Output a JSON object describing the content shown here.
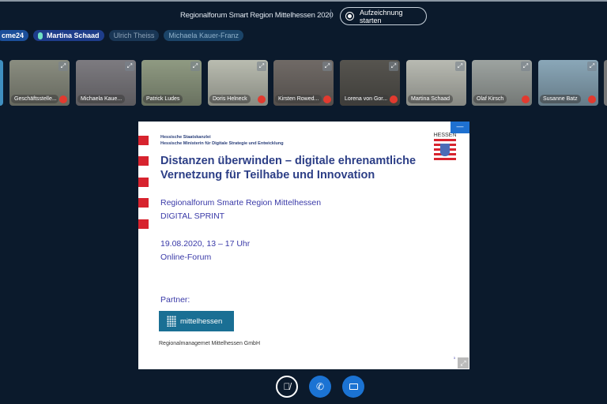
{
  "header": {
    "title": "Regionalforum Smart Region Mittelhessen 2020",
    "record_label": "Aufzeichnung starten"
  },
  "speakers": [
    {
      "name": "cme24",
      "style": "a"
    },
    {
      "name": "Martina Schaad",
      "style": "b"
    },
    {
      "name": "Ulrich Theiss",
      "style": "c"
    },
    {
      "name": "Michaela Kauer-Franz",
      "style": "d"
    }
  ],
  "tiles": [
    {
      "name": "Geschäftsstelle...",
      "muted": true,
      "color": "#8a8d80"
    },
    {
      "name": "Michaela Kaue...",
      "muted": false,
      "color": "#7d7b80"
    },
    {
      "name": "Patrick Ludes",
      "muted": false,
      "color": "#8f9a82"
    },
    {
      "name": "Doris Helneck",
      "muted": true,
      "color": "#b9bcb0"
    },
    {
      "name": "Kirsten Rowed...",
      "muted": true,
      "color": "#706a66"
    },
    {
      "name": "Lorena von Gor...",
      "muted": true,
      "color": "#56544f"
    },
    {
      "name": "Martina Schaad",
      "muted": false,
      "color": "#b8bab2"
    },
    {
      "name": "Olaf Kirsch",
      "muted": true,
      "color": "#9da3a0"
    },
    {
      "name": "Susanne Batz",
      "muted": true,
      "color": "#8aa7b8"
    }
  ],
  "slide": {
    "org1": "Hessische Staatskanzlei",
    "org2": "Hessische Ministerin für Digitale Strategie und Entwicklung",
    "title1": "Distanzen überwinden – digitale ehrenamtliche",
    "title2": "Vernetzung für Teilhabe und Innovation",
    "line1": "Regionalforum Smarte Region Mittelhessen",
    "line2": "DIGITAL SPRINT",
    "date": "19.08.2020, 13 – 17 Uhr",
    "format": "Online-Forum",
    "partner_label": "Partner:",
    "partner_logo": "mittelhessen",
    "partner_name": "Regionalmanagemet Mittelhessen GmbH",
    "state_logo": "HESSEN",
    "page": "3"
  }
}
